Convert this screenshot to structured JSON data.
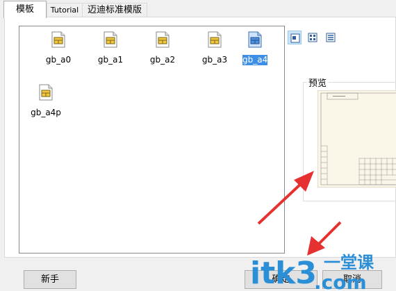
{
  "tabs": [
    {
      "label": "模板",
      "active": true
    },
    {
      "label": "Tutorial",
      "active": false
    },
    {
      "label": "迈迪标准模版",
      "active": false
    }
  ],
  "files": [
    {
      "name": "gb_a0",
      "icon": "drawing-template-icon",
      "selected": false
    },
    {
      "name": "gb_a1",
      "icon": "drawing-template-icon",
      "selected": false
    },
    {
      "name": "gb_a2",
      "icon": "drawing-template-icon",
      "selected": false
    },
    {
      "name": "gb_a3",
      "icon": "drawing-template-icon",
      "selected": false
    },
    {
      "name": "gb_a4",
      "icon": "drawing-template-icon",
      "selected": true
    },
    {
      "name": "gb_a4p",
      "icon": "drawing-template-icon",
      "selected": false
    }
  ],
  "view_modes": [
    {
      "icon": "large-icons-view-icon",
      "active": true
    },
    {
      "icon": "small-icons-view-icon",
      "active": false
    },
    {
      "icon": "list-view-icon",
      "active": false
    }
  ],
  "preview": {
    "title": "预览"
  },
  "buttons": {
    "novice": "新手",
    "ok": "确定",
    "cancel": "取消"
  },
  "watermark": {
    "brand": "itk3",
    "cn": "一堂课",
    "domain": ".com"
  },
  "colors": {
    "selection": "#3d8ee6",
    "arrow": "#e5312f",
    "watermark": "#2a8fd6"
  }
}
